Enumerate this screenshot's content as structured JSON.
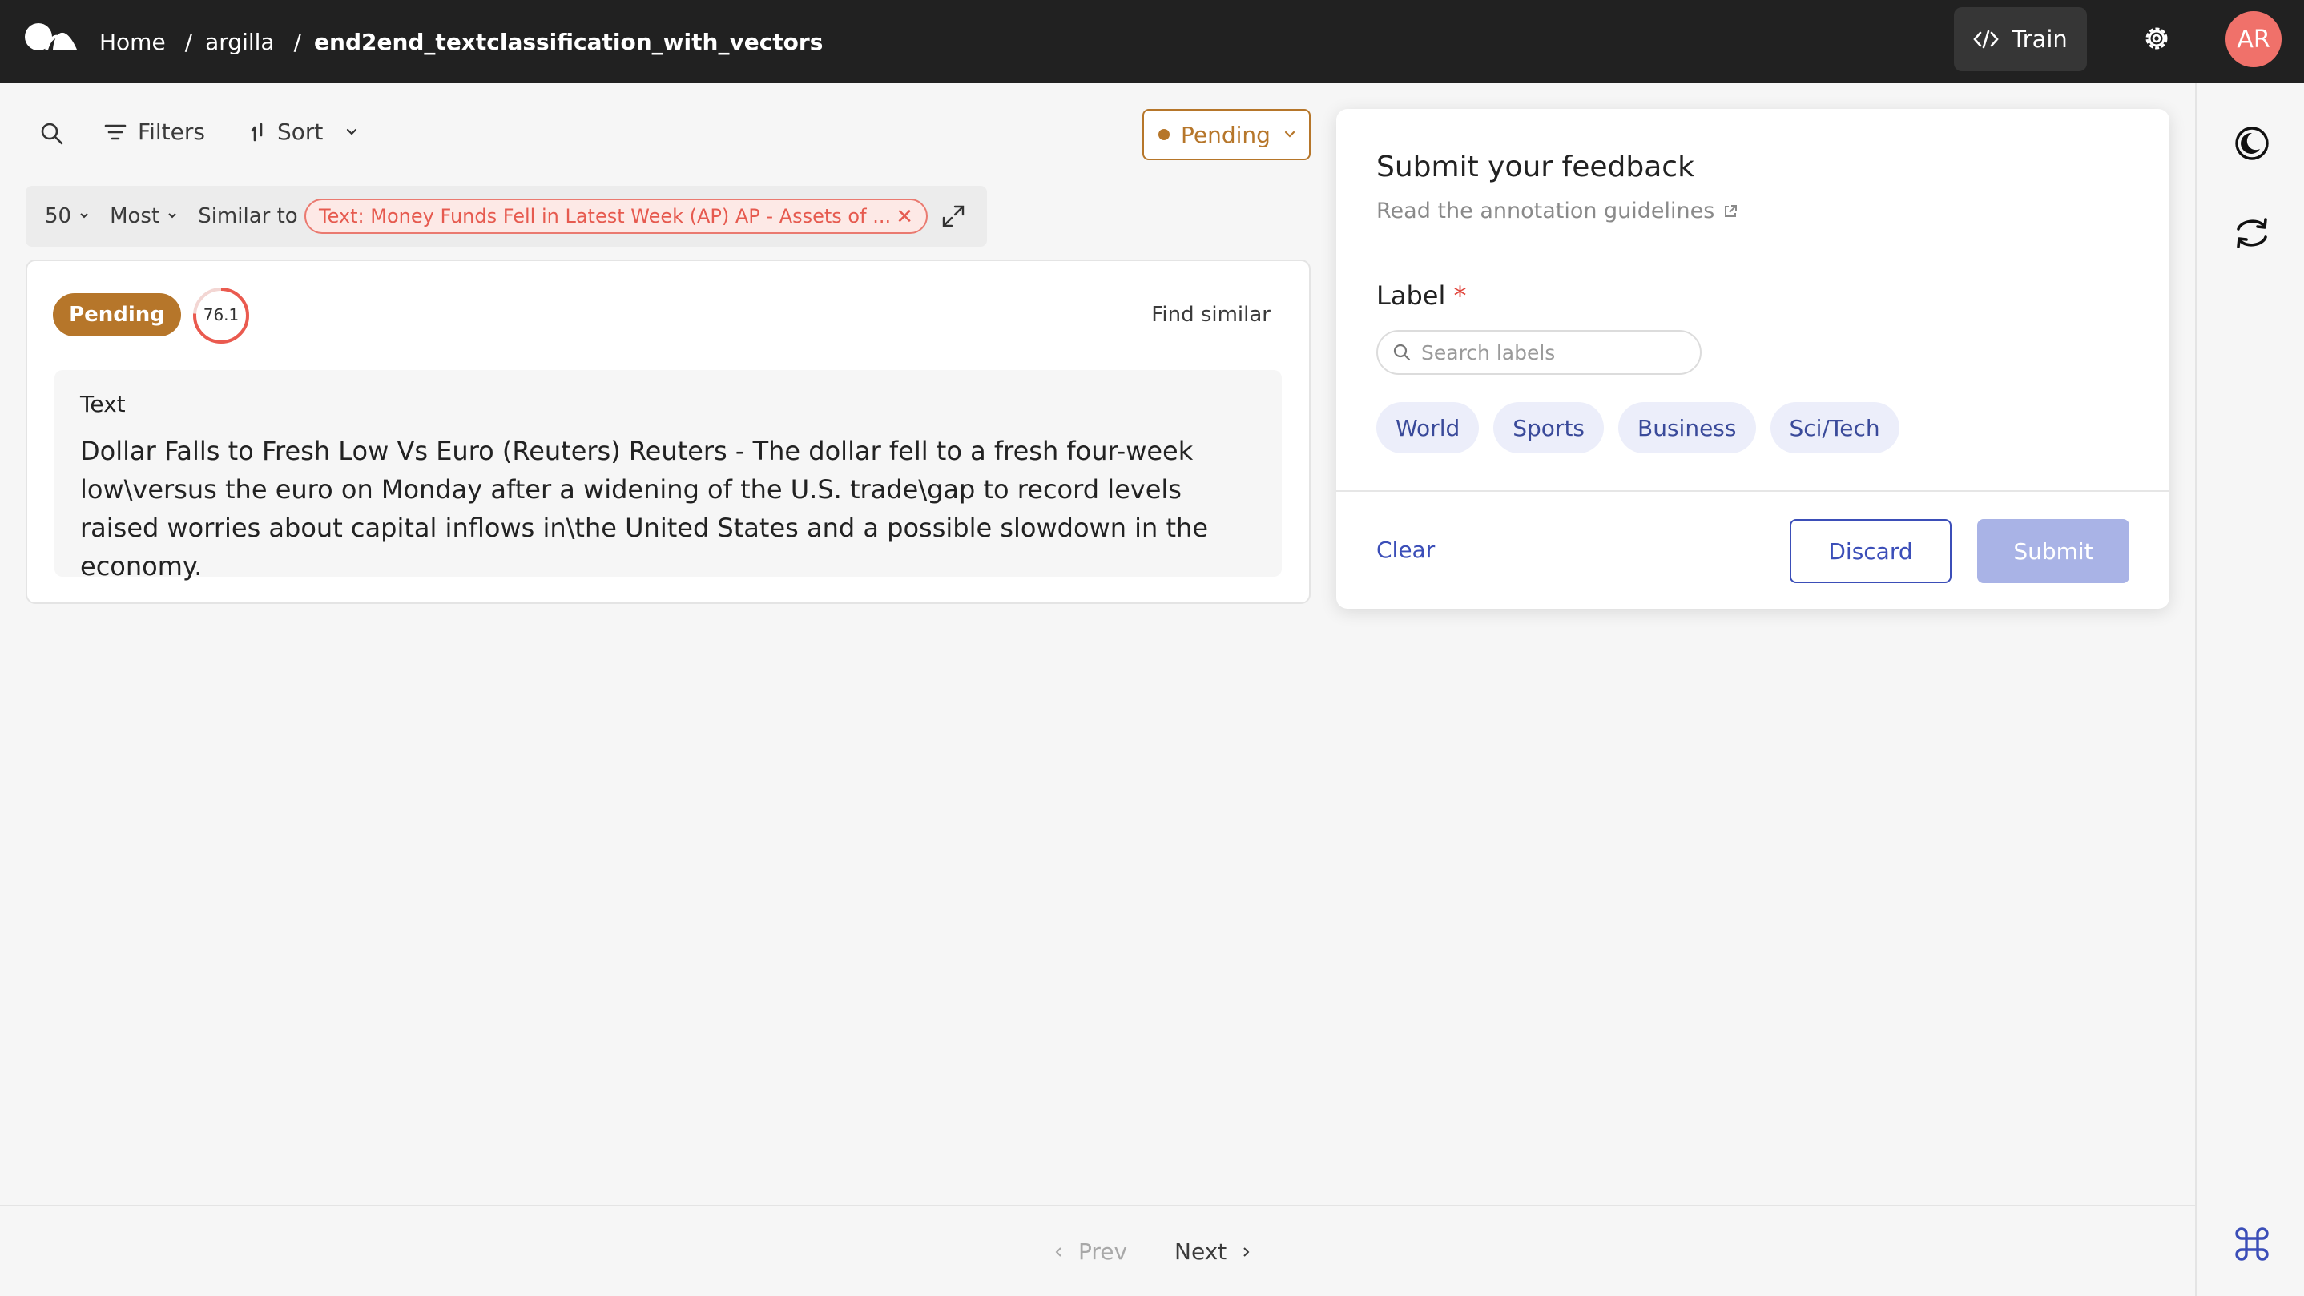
{
  "header": {
    "breadcrumbs": [
      "Home",
      "argilla",
      "end2end_textclassification_with_vectors"
    ],
    "train_label": "Train",
    "avatar_initials": "AR"
  },
  "toolbar": {
    "filters_label": "Filters",
    "sort_label": "Sort",
    "status_filter": "Pending"
  },
  "similarity": {
    "count": "50",
    "order": "Most",
    "similar_to_label": "Similar to",
    "reference_text": "Text: Money Funds Fell in Latest Week (AP) AP - Assets of ..."
  },
  "record": {
    "status": "Pending",
    "score": "76.1",
    "score_fraction": 0.761,
    "find_similar_label": "Find similar",
    "field_title": "Text",
    "field_text": "Dollar Falls to Fresh Low Vs Euro (Reuters) Reuters - The dollar fell to a fresh four-week low\\versus the euro on Monday after a widening of the U.S. trade\\gap to record levels raised worries about capital inflows in\\the United States and a possible slowdown in the economy."
  },
  "feedback": {
    "title": "Submit your feedback",
    "guidelines_link": "Read the annotation guidelines",
    "label_title": "Label",
    "required_mark": "*",
    "search_placeholder": "Search labels",
    "labels": [
      "World",
      "Sports",
      "Business",
      "Sci/Tech"
    ],
    "clear_label": "Clear",
    "discard_label": "Discard",
    "submit_label": "Submit"
  },
  "pagination": {
    "prev_label": "Prev",
    "next_label": "Next"
  },
  "colors": {
    "pending": "#b6762a",
    "accent": "#3b4eb8",
    "score_ring": "#ea5a4f"
  }
}
